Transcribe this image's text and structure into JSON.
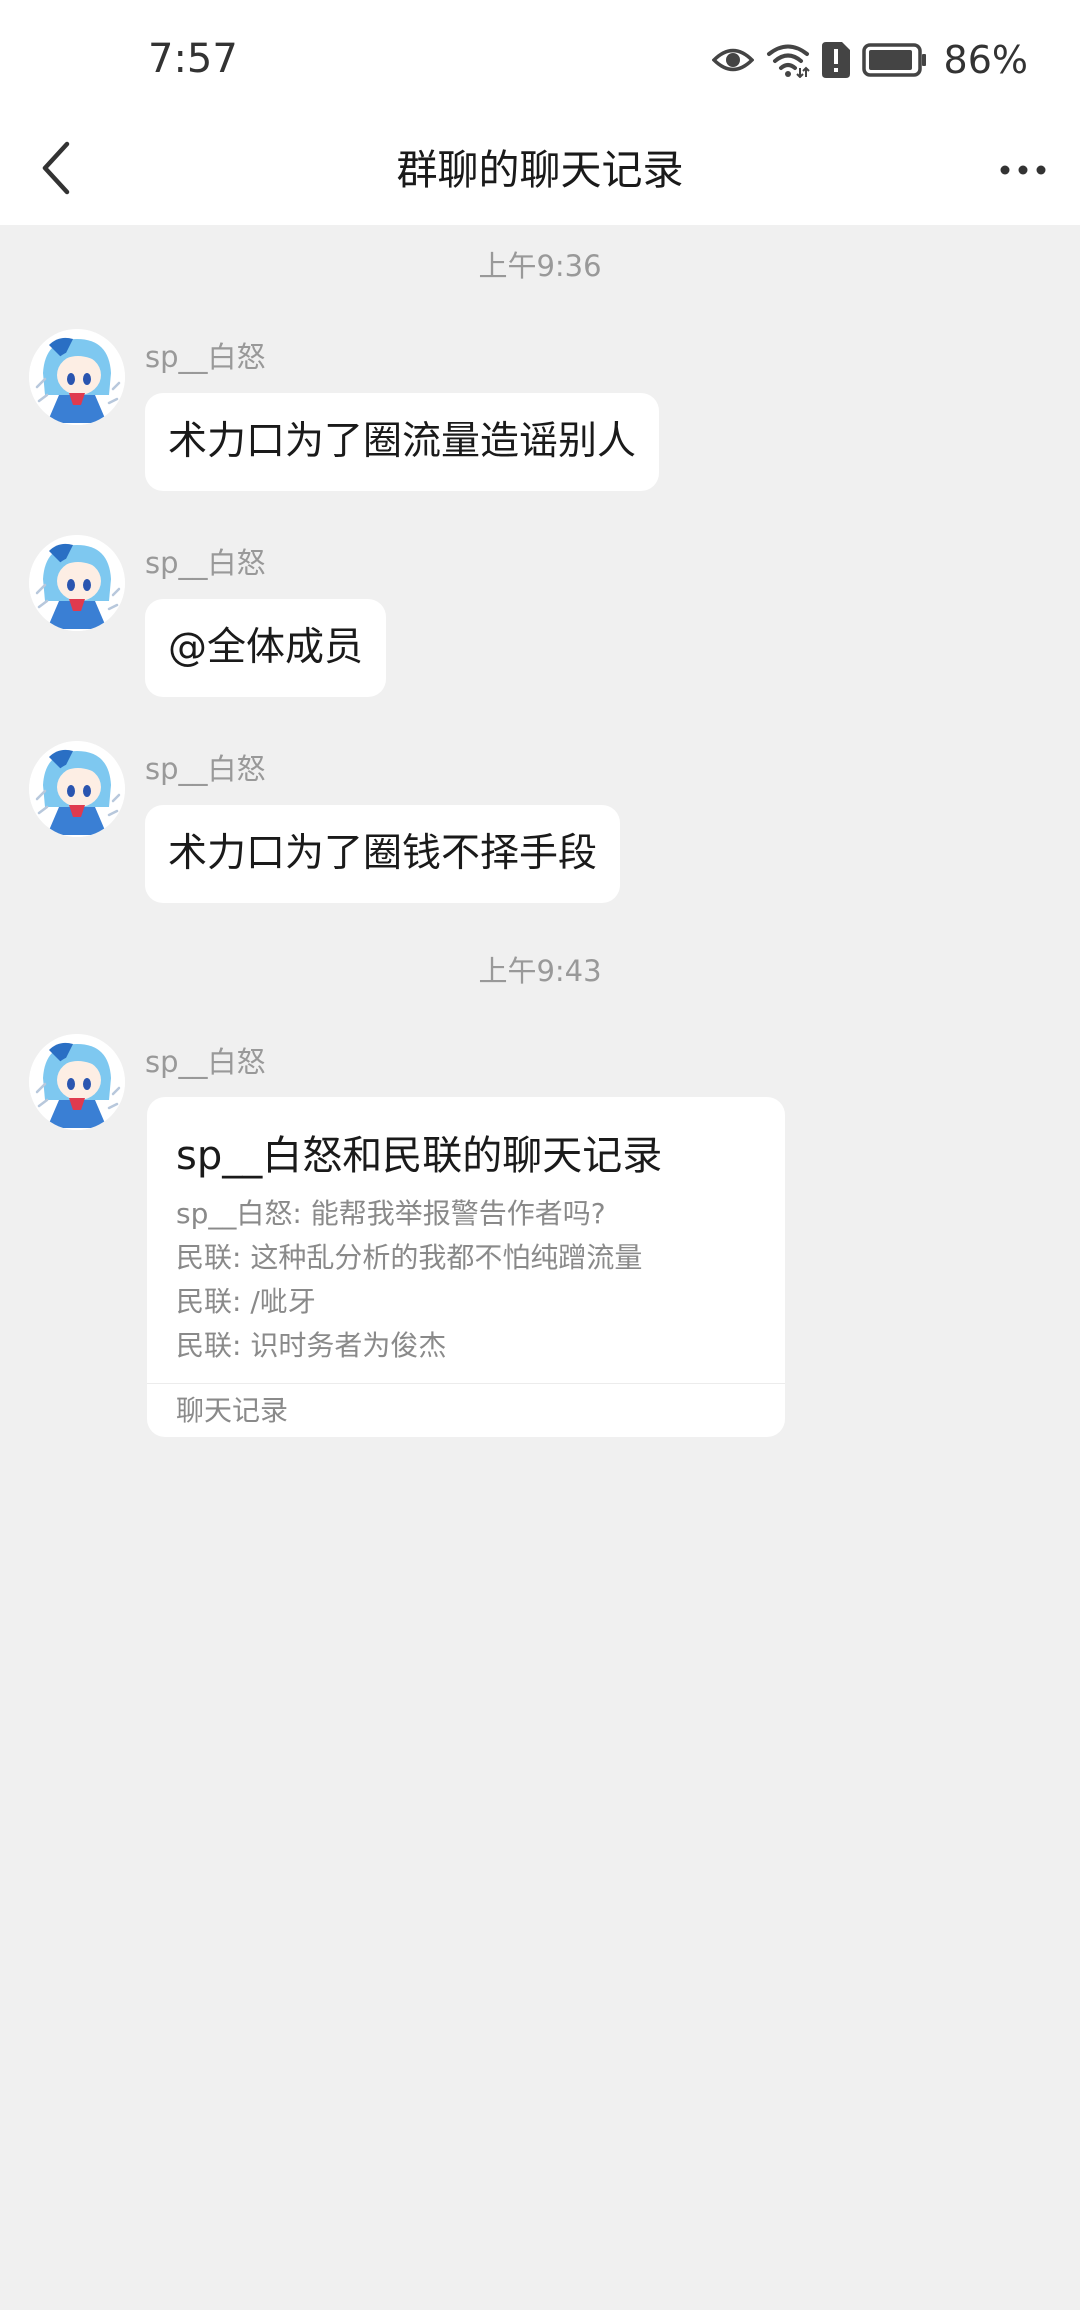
{
  "status_bar": {
    "time": "7:57",
    "battery_percent": "86%",
    "icons": [
      "eye-icon",
      "wifi-icon",
      "alert-icon",
      "battery-icon"
    ]
  },
  "nav": {
    "title": "群聊的聊天记录",
    "back_icon": "chevron-left-icon",
    "more_icon": "more-horizontal-icon"
  },
  "messages": {
    "timestamp_1": "上午9:36",
    "msg_1": {
      "sender": "sp__白怒",
      "text": "术力口为了圈流量造谣别人"
    },
    "msg_2": {
      "sender": "sp__白怒",
      "text": "@全体成员"
    },
    "msg_3": {
      "sender": "sp__白怒",
      "text": "术力口为了圈钱不择手段"
    },
    "timestamp_2": "上午9:43",
    "msg_4": {
      "sender": "sp__白怒",
      "record": {
        "title": "sp__白怒和民联的聊天记录",
        "lines": [
          "sp__白怒: 能帮我举报警告作者吗?",
          "民联: 这种乱分析的我都不怕纯蹭流量",
          "民联: /呲牙",
          "民联: 识时务者为俊杰"
        ],
        "footer": "聊天记录"
      }
    }
  },
  "colors": {
    "background": "#f0f0f0",
    "bubble": "#ffffff",
    "secondary_text": "#999999",
    "primary_text": "#1a1a1a"
  }
}
